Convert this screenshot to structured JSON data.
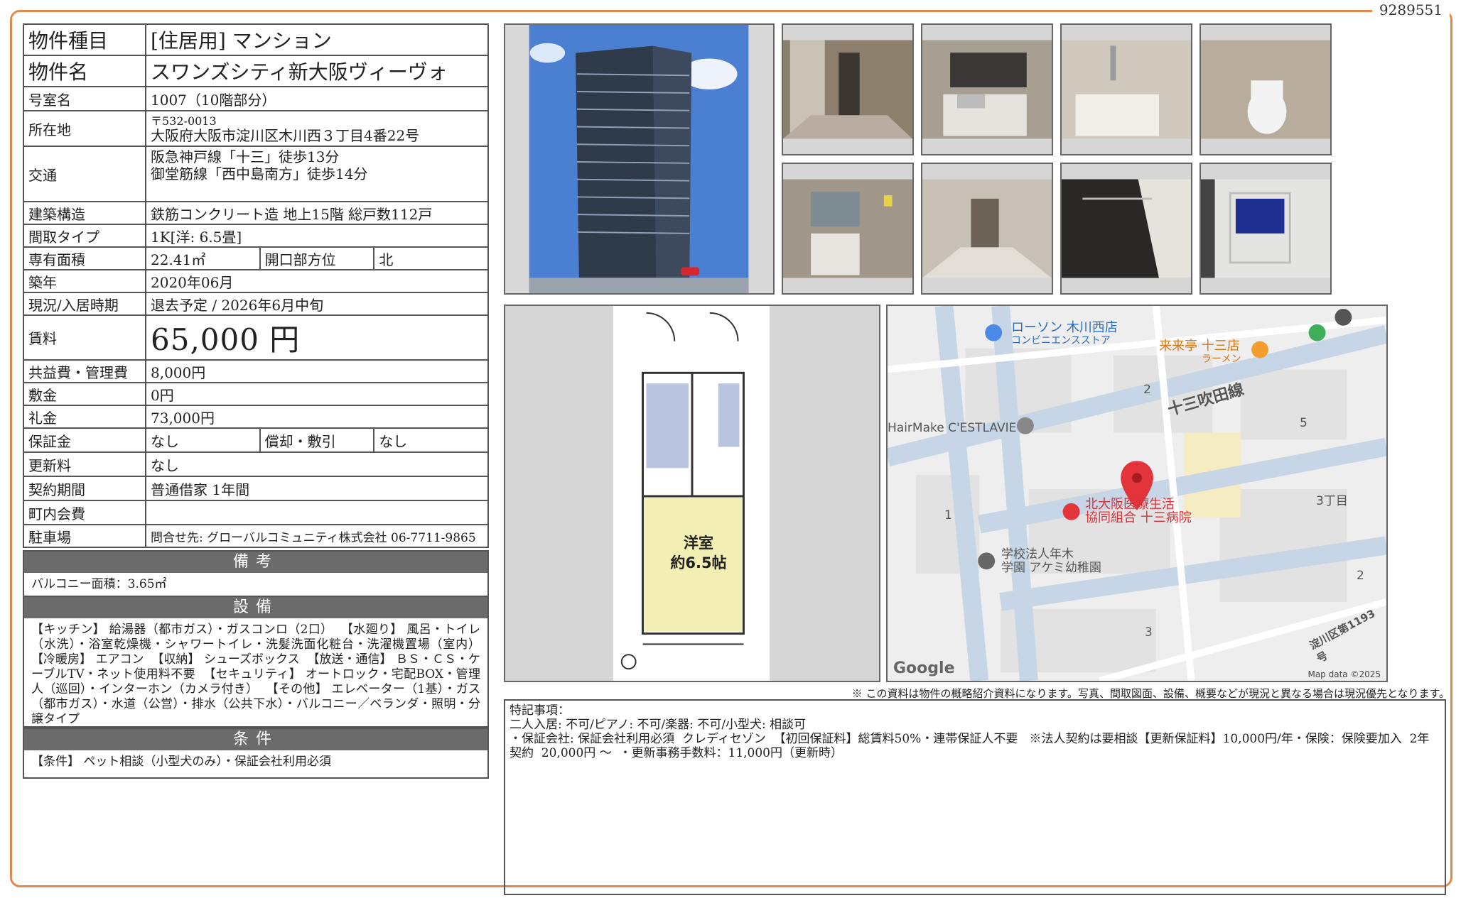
{
  "doc_number": "9289551",
  "property": {
    "type_label": "物件種目",
    "type_value": "[住居用]  マンション",
    "name_label": "物件名",
    "name_value": "スワンズシティ新大阪ヴィーヴォ",
    "room_label": "号室名",
    "room_value": "1007（10階部分）",
    "address_label": "所在地",
    "postal": "〒532-0013",
    "address_value": "大阪府大阪市淀川区木川西３丁目4番22号",
    "transport_label": "交通",
    "transport_1": "阪急神戸線「十三」徒歩13分",
    "transport_2": "御堂筋線「西中島南方」徒歩14分",
    "structure_label": "建築構造",
    "structure_value": "鉄筋コンクリート造  地上15階  総戸数112戸",
    "layout_label": "間取タイプ",
    "layout_value": "1K[洋: 6.5畳]",
    "area_label": "専有面積",
    "area_value": "22.41㎡",
    "direction_label": "開口部方位",
    "direction_value": "北",
    "built_label": "築年",
    "built_value": "2020年06月",
    "status_label": "現況/入居時期",
    "status_value": "退去予定  /   2026年6月中旬",
    "rent_label": "賃料",
    "rent_value": "65,000 円",
    "fee_label": "共益費・管理費",
    "fee_value": "8,000円",
    "deposit_label": "敷金",
    "deposit_value": "0円",
    "key_money_label": "礼金",
    "key_money_value": "73,000円",
    "guarantee_label": "保証金",
    "guarantee_value": "なし",
    "amort_label": "償却・敷引",
    "amort_value": "なし",
    "renewal_label": "更新料",
    "renewal_value": "なし",
    "contract_label": "契約期間",
    "contract_value": "普通借家  1年間",
    "assoc_label": "町内会費",
    "assoc_value": "",
    "parking_label": "駐車場",
    "parking_value": "問合せ先: グローバルコミュニティ株式会社    06-7711-9865"
  },
  "remarks_section": {
    "title": "備考",
    "body": "バルコニー面積：3.65㎡"
  },
  "equipment_section": {
    "title": "設備",
    "body": "【キッチン】 給湯器（都市ガス）・ガスコンロ（2口）  【水廻り】 風呂・トイレ（水洗）・浴室乾燥機・シャワートイレ・洗髪洗面化粧台・洗濯機置場（室内）  【冷暖房】 エアコン  【収納】 シューズボックス  【放送・通信】 ＢＳ・ＣＳ・ケーブルTV・ネット使用料不要  【セキュリティ】 オートロック・宅配BOX・管理人（巡回）・インターホン（カメラ付き）  【その他】 エレベーター（1基）・ガス（都市ガス）・水道（公営）・排水（公共下水）・バルコニー／ベランダ・照明・分譲タイプ"
  },
  "conditions_section": {
    "title": "条件",
    "body": "【条件】 ペット相談（小型犬のみ）・保証会社利用必須"
  },
  "floorplan": {
    "room_name": "洋室",
    "room_size": "約6.5帖"
  },
  "map": {
    "labels": [
      "ローソン 木川西店",
      "コンビニエンスストア",
      "来来亭 十三店",
      "ラーメン",
      "HairMake C'ESTLAVIE",
      "十三吹田線",
      "北大阪医療生活",
      "協同組合 十三病院",
      "学校法人年木",
      "学園 アケミ幼稚園",
      "3丁目",
      "淀川区第1193号",
      "Google",
      "Map data ©2025"
    ],
    "block_numbers": [
      "2",
      "5",
      "1",
      "2",
      "3"
    ]
  },
  "disclaimer": "※  この資料は物件の概略紹介資料になります。写真、間取図面、設備、概要などが現況と異なる場合は現況優先となります。",
  "special_notes": {
    "title": "特記事項：",
    "line1": "二人入居: 不可/ピアノ: 不可/楽器: 不可/小型犬: 相談可",
    "line2": "・保証会社: 保証会社利用必須  クレディセゾン  【初回保証料】総賃料50%・連帯保証人不要   ※法人契約は要相談【更新保証料】10,000円/年・保険：保険要加入  2年契約  20,000円 ～  ・更新事務手数料：11,000円（更新時）"
  }
}
